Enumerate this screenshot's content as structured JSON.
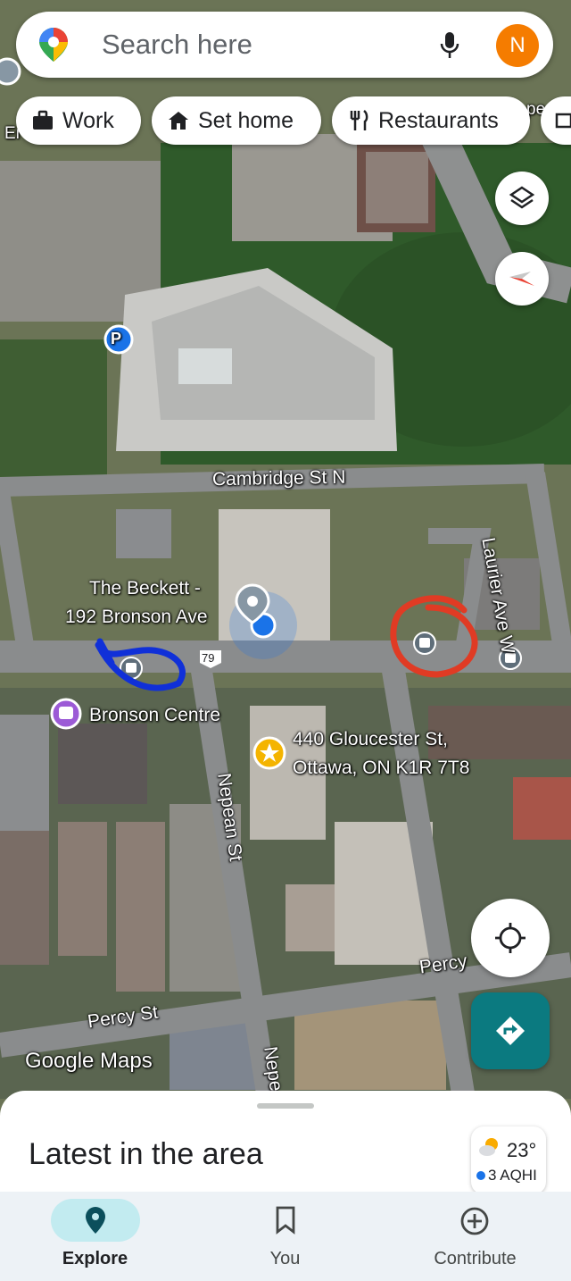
{
  "search": {
    "placeholder": "Search here",
    "avatar_letter": "N"
  },
  "chips": [
    {
      "label": "Work",
      "icon": "briefcase-icon"
    },
    {
      "label": "Set home",
      "icon": "home-icon"
    },
    {
      "label": "Restaurants",
      "icon": "fork-knife-icon"
    }
  ],
  "map_labels": {
    "partial_left": "Er",
    "partial_right": "pe",
    "cambridge": "Cambridge St N",
    "laurier": "Laurier Ave W",
    "beckett_line1": "The Beckett -",
    "beckett_line2": "192 Bronson Ave",
    "route": "79",
    "bronson_centre": "Bronson Centre",
    "address_line1": "440 Gloucester St,",
    "address_line2": "Ottawa, ON K1R 7T8",
    "nepean": "Nepean St",
    "nepean_partial": "Nepe",
    "percy_right": "Percy",
    "percy_left": "Percy St",
    "watermark": "Google Maps",
    "parking": "P"
  },
  "sheet": {
    "title": "Latest in the area"
  },
  "weather": {
    "temperature": "23°",
    "aqhi": "3 AQHI",
    "aqhi_color": "#1a73e8"
  },
  "bottom_nav": [
    {
      "label": "Explore",
      "active": true
    },
    {
      "label": "You",
      "active": false
    },
    {
      "label": "Contribute",
      "active": false
    }
  ],
  "colors": {
    "accent_teal": "#0b7a80",
    "annotation_red": "#e03b24",
    "annotation_blue": "#1030d8",
    "location_blue": "#1a73e8"
  }
}
